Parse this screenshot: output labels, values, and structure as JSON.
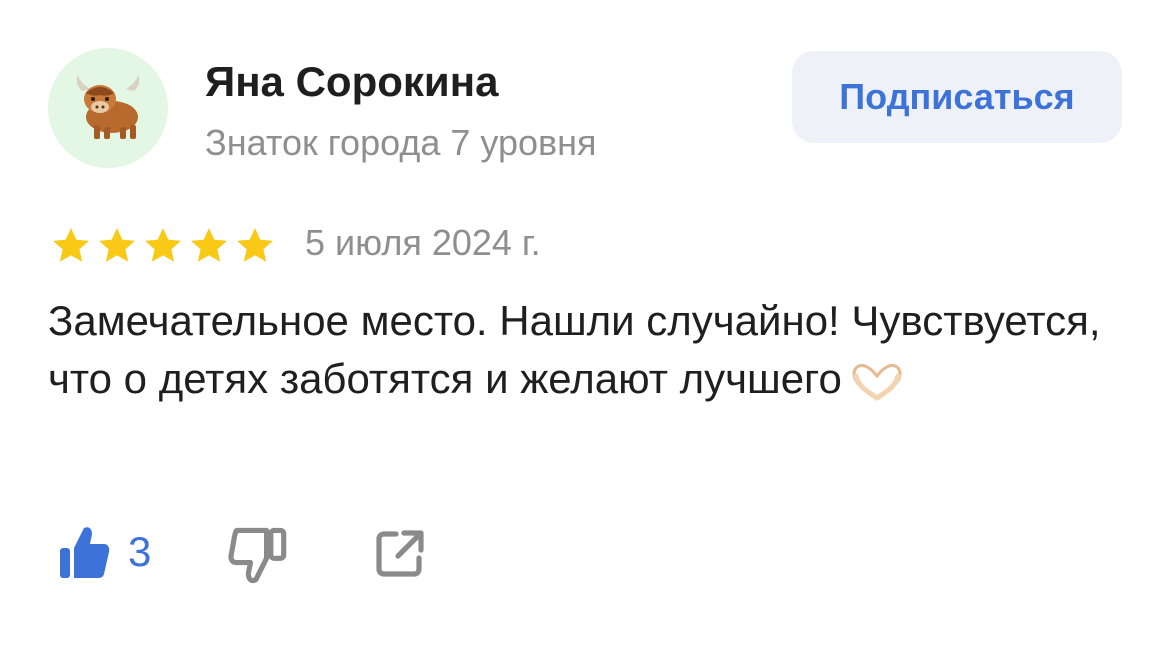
{
  "author": {
    "name": "Яна Сорокина",
    "level": "Знаток города 7 уровня",
    "avatar_icon": "yak-emoji-icon",
    "avatar_bg": "#e4f6e4"
  },
  "actions": {
    "subscribe_label": "Подписаться"
  },
  "review": {
    "rating": 5,
    "rating_max": 5,
    "date": "5 июля 2024 г.",
    "text": "Замечательное место. Нашли случайно! Чувствуется, что о детях заботятся и желают лучшего",
    "emoji_icon": "heart-hands-icon"
  },
  "reactions": {
    "likes": "3",
    "like_icon": "thumbs-up-icon",
    "dislike_icon": "thumbs-down-icon",
    "share_icon": "share-icon"
  },
  "colors": {
    "accent": "#3d73d8",
    "star": "#f9c918",
    "muted_text": "#8f8f8f",
    "button_bg": "#eef2f8"
  }
}
